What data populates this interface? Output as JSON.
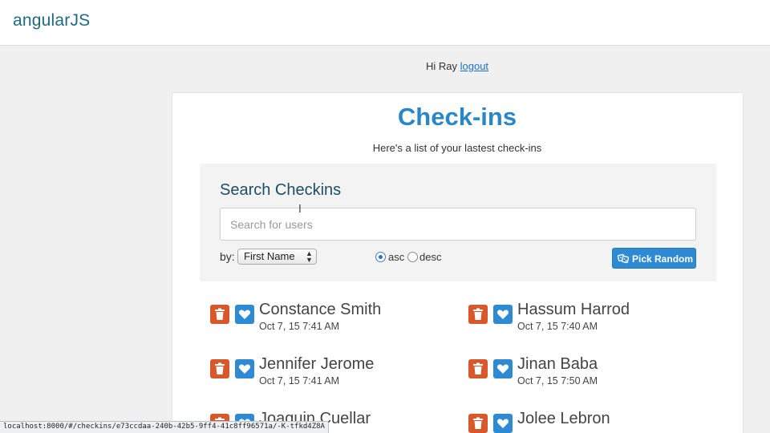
{
  "navbar": {
    "brand": "angularJS"
  },
  "greeting": {
    "text": "Hi Ray",
    "logout_label": "logout"
  },
  "page": {
    "title": "Check-ins",
    "subtitle": "Here's a list of your lastest check-ins"
  },
  "search": {
    "heading": "Search Checkins",
    "placeholder": "Search for users",
    "value": "",
    "by_label": "by:",
    "sort_selected": "First Name",
    "order": {
      "asc_label": "asc",
      "desc_label": "desc",
      "selected": "asc"
    },
    "pick_random_label": "Pick Random"
  },
  "checkins": [
    {
      "name": "Constance Smith",
      "time": "Oct 7, 15 7:41 AM"
    },
    {
      "name": "Hassum Harrod",
      "time": "Oct 7, 15 7:40 AM"
    },
    {
      "name": "Jennifer Jerome",
      "time": "Oct 7, 15 7:41 AM"
    },
    {
      "name": "Jinan Baba",
      "time": "Oct 7, 15 7:50 AM"
    },
    {
      "name": "Joaquin Cuellar",
      "time": ""
    },
    {
      "name": "Jolee Lebron",
      "time": ""
    }
  ],
  "icons": {
    "delete": "trash-icon",
    "favorite": "heart-icon",
    "random": "dice-icon"
  },
  "colors": {
    "brand": "#1f6b85",
    "accent": "#2f8ad4",
    "danger": "#d9582b",
    "title": "#2b86c8"
  },
  "status_bar": {
    "url": "localhost:8000/#/checkins/e73ccdaa-240b-42b5-9ff4-41c8ff96571a/-K-tfkd4Z8A"
  }
}
